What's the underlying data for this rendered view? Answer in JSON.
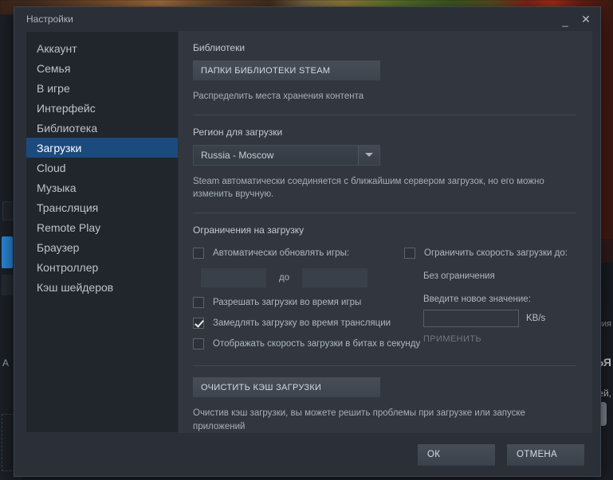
{
  "window": {
    "title": "Настройки",
    "minimize_label": "_",
    "close_label": "✕"
  },
  "sidebar": {
    "items": [
      {
        "label": "Аккаунт",
        "selected": false
      },
      {
        "label": "Семья",
        "selected": false
      },
      {
        "label": "В игре",
        "selected": false
      },
      {
        "label": "Интерфейс",
        "selected": false
      },
      {
        "label": "Библиотека",
        "selected": false
      },
      {
        "label": "Загрузки",
        "selected": true
      },
      {
        "label": "Cloud",
        "selected": false
      },
      {
        "label": "Музыка",
        "selected": false
      },
      {
        "label": "Трансляция",
        "selected": false
      },
      {
        "label": "Remote Play",
        "selected": false
      },
      {
        "label": "Браузер",
        "selected": false
      },
      {
        "label": "Контроллер",
        "selected": false
      },
      {
        "label": "Кэш шейдеров",
        "selected": false
      }
    ]
  },
  "content": {
    "libraries": {
      "heading": "Библиотеки",
      "folders_button": "ПАПКИ БИБЛИОТЕКИ STEAM",
      "hint": "Распределить места хранения контента"
    },
    "region": {
      "heading": "Регион для загрузки",
      "selected": "Russia - Moscow",
      "hint": "Steam автоматически соединяется с ближайшим сервером загрузок, но его можно изменить вручную."
    },
    "limits": {
      "heading": "Ограничения на загрузку",
      "auto_update_label": "Автоматически обновлять игры:",
      "auto_update_checked": false,
      "time_from": "",
      "time_to": "",
      "time_separator": "до",
      "allow_during_game_label": "Разрешать загрузки во время игры",
      "allow_during_game_checked": false,
      "throttle_broadcast_label": "Замедлять загрузку во время трансляции",
      "throttle_broadcast_checked": true,
      "show_bits_label": "Отображать скорость загрузки в битах в секунду",
      "show_bits_checked": false,
      "limit_speed_label": "Ограничить скорость загрузки до:",
      "limit_speed_checked": false,
      "no_limit_text": "Без ограничения",
      "new_value_label": "Введите новое значение:",
      "new_value": "",
      "unit": "KB/s",
      "apply_label": "ПРИМЕНИТЬ"
    },
    "cache": {
      "clear_button": "ОЧИСТИТЬ КЭШ ЗАГРУЗКИ",
      "hint": "Очистив кэш загрузки, вы можете решить проблемы при загрузке или запуске приложений"
    }
  },
  "footer": {
    "ok_label": "ОК",
    "cancel_label": "ОТМЕНА"
  },
  "background": {
    "left_letter": "А",
    "right_text_1": "ения",
    "right_text_2": "ЬЯ",
    "right_text_3": "ей,"
  },
  "colors": {
    "accent": "#1b4a7e",
    "dialog_bg": "#2a2f38",
    "content_bg": "#32373f",
    "sidebar_bg": "#21262d",
    "text": "#bcc3cb"
  }
}
